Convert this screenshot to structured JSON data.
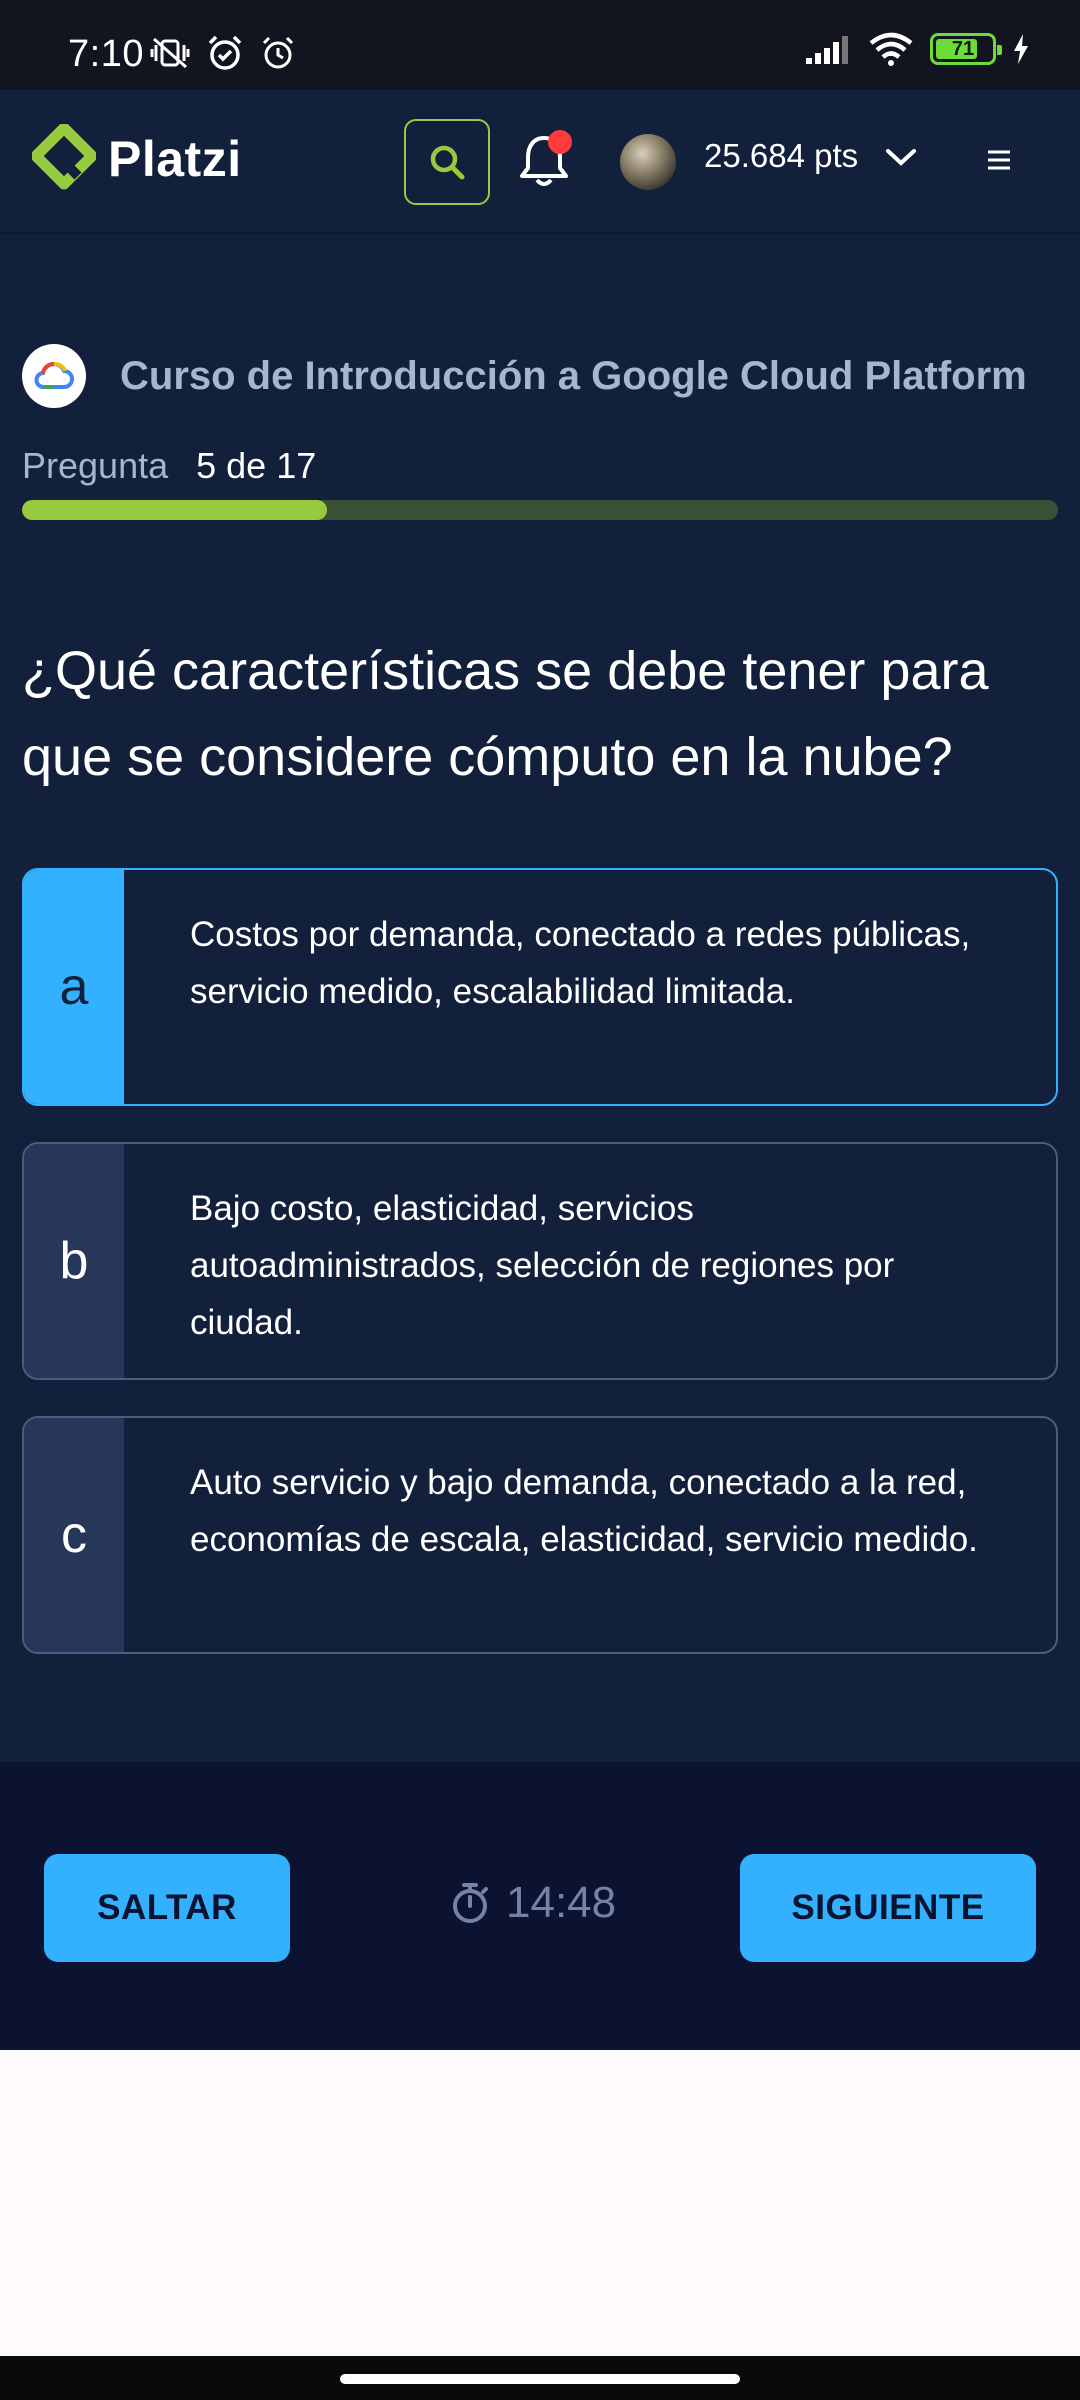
{
  "status_bar": {
    "time": "7:10",
    "battery": "71",
    "icons": [
      "vibrate-off-icon",
      "alarm-check-icon",
      "alarm-icon",
      "signal-icon",
      "wifi-icon",
      "battery-icon",
      "charging-icon"
    ]
  },
  "header": {
    "logo_text": "Platzi",
    "points": "25.684 pts",
    "icons": [
      "platzi-logo-icon",
      "search-icon",
      "bell-icon",
      "avatar",
      "chevron-down-icon",
      "menu-icon"
    ]
  },
  "course": {
    "title": "Curso de Introducción a Google Cloud Platform",
    "icon": "google-cloud-icon"
  },
  "progress": {
    "label": "Pregunta",
    "count": "5 de 17",
    "current": 5,
    "total": 17,
    "fraction": 0.294
  },
  "question": {
    "text": "¿Qué características se debe tener para que se considere cómputo en la nube?",
    "options": [
      {
        "letter": "a",
        "text": "Costos por demanda, conectado a redes públicas, servicio medido, escalabilidad limitada.",
        "selected": true
      },
      {
        "letter": "b",
        "text": "Bajo costo, elasticidad, servicios autoadministrados, selección de regiones por ciudad.",
        "selected": false
      },
      {
        "letter": "c",
        "text": "Auto servicio y bajo demanda, conectado a la red, economías de escala, elasticidad, servicio medido.",
        "selected": false
      }
    ]
  },
  "footer": {
    "skip_label": "SALTAR",
    "next_label": "SIGUIENTE",
    "timer": "14:48",
    "timer_icon": "stopwatch-icon"
  },
  "colors": {
    "background": "#13203b",
    "accent": "#33b1ff",
    "brand_green": "#98ca3f",
    "notification": "#ff3b3b"
  }
}
